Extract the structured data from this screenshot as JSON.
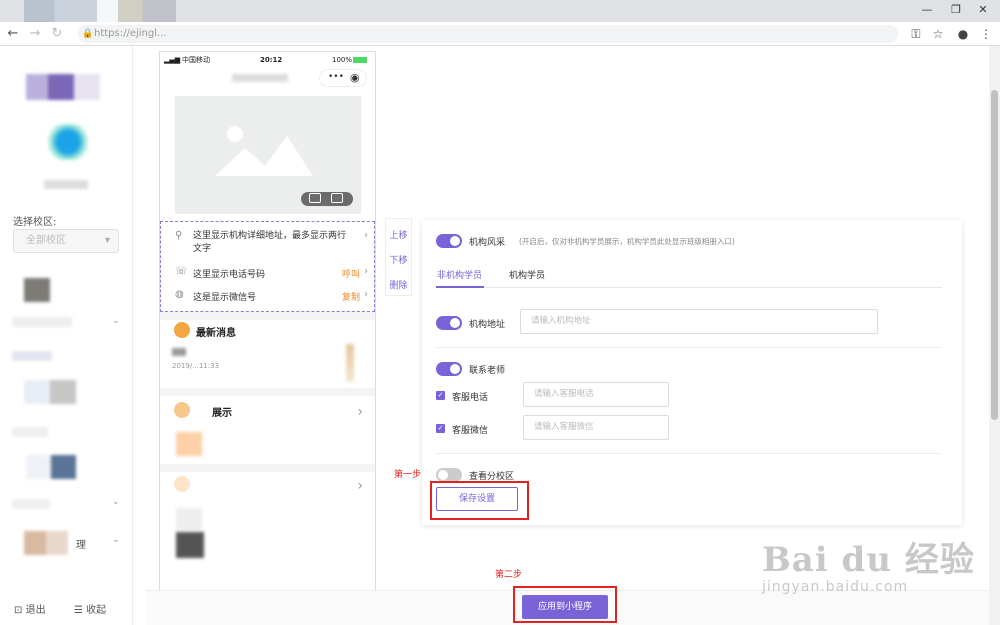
{
  "browser": {
    "url": "https://ejingl...",
    "lock_icon": "lock-icon",
    "controls": {
      "minimize": "—",
      "restore": "❐",
      "close": "✕"
    }
  },
  "sidebar": {
    "campus_label": "选择校区:",
    "campus_select_value": "全部校区",
    "footer_logout": "退出",
    "footer_collapse": "收起",
    "menu_partial_manage": "理"
  },
  "phone": {
    "status_carrier": "中国移动",
    "status_time": "20:12",
    "status_battery": "100%",
    "info_address": "这里显示机构详细地址，最多显示两行文字",
    "info_phone": "这里显示电话号码",
    "info_phone_action": "呼叫",
    "info_wechat": "这是显示微信号",
    "info_wechat_action": "复制",
    "news_title": "最新消息",
    "news_date": "2019/...11:33",
    "show_title": "展示"
  },
  "move_controls": {
    "up": "上移",
    "down": "下移",
    "delete": "删除"
  },
  "settings": {
    "style_label": "机构风采",
    "style_hint": "(开启后，仅对非机构学员展示，机构学员此处显示班级相册入口)",
    "tab_non_member": "非机构学员",
    "tab_member": "机构学员",
    "address_label": "机构地址",
    "address_placeholder": "请输入机构地址",
    "contact_label": "联系老师",
    "phone_label": "客服电话",
    "phone_placeholder": "请输入客服电话",
    "wechat_label": "客服微信",
    "wechat_placeholder": "请输入客服微信",
    "branch_label": "查看分校区",
    "save_button": "保存设置"
  },
  "annotations": {
    "step1": "第一步",
    "step2": "第二步"
  },
  "apply_button": "应用到小程序",
  "watermark": {
    "main": "Bai du 经验",
    "sub": "jingyan.baidu.com"
  },
  "colors": {
    "accent": "#7a63d6",
    "highlight_red": "#e32222",
    "action_orange": "#f08a24"
  }
}
